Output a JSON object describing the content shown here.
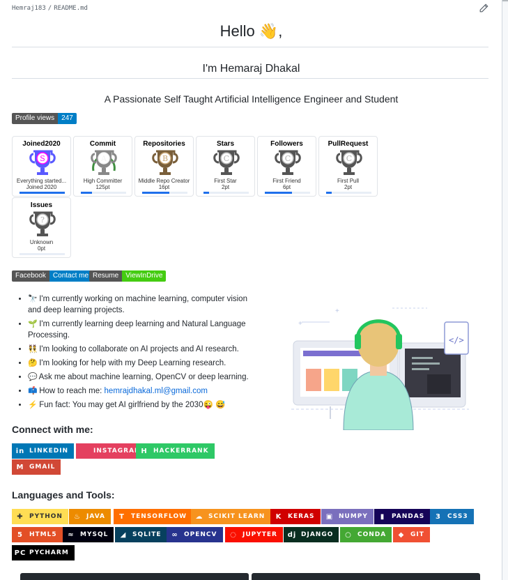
{
  "breadcrumb": {
    "user": "Hemraj183",
    "separator": "/",
    "file": "README.md"
  },
  "header": {
    "greeting": "Hello 👋,",
    "name": "I'm Hemaraj Dhakal",
    "tagline": "A Passionate Self Taught Artificial Intelligence Engineer and Student"
  },
  "profile_views": {
    "label": "Profile views",
    "count": "247",
    "color": "#007ec6"
  },
  "trophies": [
    {
      "title": "Joined2020",
      "rank": "S",
      "line1": "Everything started...",
      "line2": "Joined 2020",
      "progress": 1.0
    },
    {
      "title": "Commit",
      "rank": "A",
      "line1": "High Committer",
      "line2": "125pt",
      "progress": 0.25
    },
    {
      "title": "Repositories",
      "rank": "B",
      "line1": "Middle Repo Creator",
      "line2": "16pt",
      "progress": 0.6
    },
    {
      "title": "Stars",
      "rank": "C",
      "line1": "First Star",
      "line2": "2pt",
      "progress": 0.12
    },
    {
      "title": "Followers",
      "rank": "C",
      "line1": "First Friend",
      "line2": "6pt",
      "progress": 0.6
    },
    {
      "title": "PullRequest",
      "rank": "C",
      "line1": "First Pull",
      "line2": "2pt",
      "progress": 0.12
    },
    {
      "title": "Issues",
      "rank": "?",
      "line1": "Unknown",
      "line2": "0pt",
      "progress": 0.0
    }
  ],
  "links": [
    {
      "left": "Facebook",
      "right": "Contact me",
      "color": "#007ec6"
    },
    {
      "left": "Resume",
      "right": "ViewInDrive",
      "color": "#4c1"
    }
  ],
  "about": [
    {
      "icon": "telescope-icon",
      "text": "I'm currently working on machine learning, computer vision and deep learning projects."
    },
    {
      "icon": "seedling-icon",
      "text": "I'm currently learning deep learning and Natural Language Processing."
    },
    {
      "icon": "people-icon",
      "text": "I'm looking to collaborate on AI projects and AI research."
    },
    {
      "icon": "thinking-icon",
      "text": "I'm looking for help with my Deep Learning research."
    },
    {
      "icon": "speech-icon",
      "text": "Ask me about machine learning, OpenCV or deep learning."
    },
    {
      "icon": "mailbox-icon",
      "text": "How to reach me: ",
      "link": "hemrajdhakal.ml@gmail.com"
    },
    {
      "icon": "lightning-icon",
      "text": "Fun fact: You may get AI girlfriend by the 2030",
      "suffix": "😜 😅"
    }
  ],
  "connect": {
    "heading": "Connect with me:",
    "buttons": [
      {
        "label": "LINKEDIN",
        "color": "#0077b5",
        "icon": "in"
      },
      {
        "label": "INSTAGRAM",
        "color": "#e4405f",
        "icon": ""
      },
      {
        "label": "HACKERRANK",
        "color": "#2ec866",
        "icon": "H"
      },
      {
        "label": "GMAIL",
        "color": "#d14836",
        "icon": "M"
      }
    ]
  },
  "tools": {
    "heading": "Languages and Tools:",
    "buttons": [
      {
        "label": "PYTHON",
        "color": "#ffdd54",
        "text": "#333",
        "icon": "✚"
      },
      {
        "label": "JAVA",
        "color": "#ed8b00",
        "text": "#fff",
        "icon": "♨"
      },
      {
        "label": "TENSORFLOW",
        "color": "#ff6f00",
        "text": "#fff",
        "icon": "T"
      },
      {
        "label": "SCIKIT LEARN",
        "color": "#f7931e",
        "text": "#fff",
        "icon": "☁"
      },
      {
        "label": "KERAS",
        "color": "#d00000",
        "text": "#fff",
        "icon": "K"
      },
      {
        "label": "NUMPY",
        "color": "#013243",
        "text": "#fff",
        "icon": "▣",
        "alt": "#7a6fbd"
      },
      {
        "label": "PANDAS",
        "color": "#150458",
        "text": "#fff",
        "icon": "▮"
      },
      {
        "label": "CSS3",
        "color": "#1572b6",
        "text": "#fff",
        "icon": "3"
      },
      {
        "label": "HTML5",
        "color": "#e34f26",
        "text": "#fff",
        "icon": "5"
      },
      {
        "label": "MYSQL",
        "color": "#00000f",
        "text": "#fff",
        "icon": "≈"
      },
      {
        "label": "SQLITE",
        "color": "#07405e",
        "text": "#fff",
        "icon": "◢"
      },
      {
        "label": "OPENCV",
        "color": "#27338e",
        "text": "#fff",
        "icon": "∞"
      },
      {
        "label": "JUPYTER",
        "color": "#fa0f00",
        "text": "#fff",
        "icon": "◌"
      },
      {
        "label": "DJANGO",
        "color": "#092e20",
        "text": "#fff",
        "icon": "dj"
      },
      {
        "label": "CONDA",
        "color": "#342b029",
        "text": "#fff",
        "icon": "○"
      },
      {
        "label": "GIT",
        "color": "#f05033",
        "text": "#fff",
        "icon": "◆"
      },
      {
        "label": "PYCHARM",
        "color": "#000000",
        "text": "#fff",
        "icon": "PC"
      }
    ]
  }
}
